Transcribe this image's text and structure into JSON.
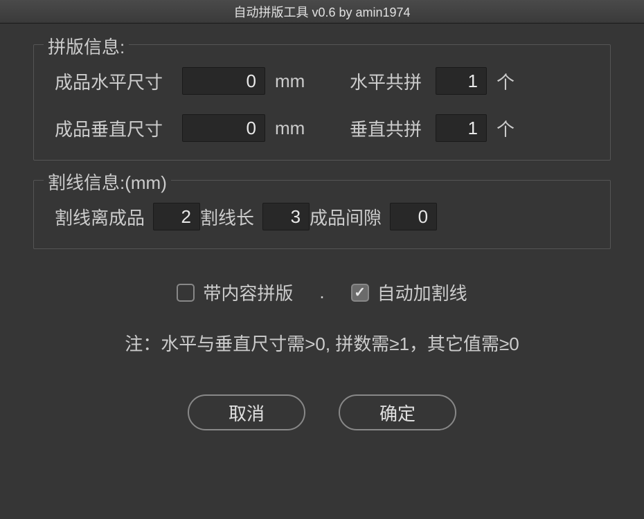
{
  "title": "自动拼版工具 v0.6   by amin1974",
  "imposition": {
    "legend": "拼版信息:",
    "horizontal_size_label": "成品水平尺寸",
    "horizontal_size_value": "0",
    "horizontal_size_unit": "mm",
    "horizontal_count_label": "水平共拼",
    "horizontal_count_value": "1",
    "horizontal_count_unit": "个",
    "vertical_size_label": "成品垂直尺寸",
    "vertical_size_value": "0",
    "vertical_size_unit": "mm",
    "vertical_count_label": "垂直共拼",
    "vertical_count_value": "1",
    "vertical_count_unit": "个"
  },
  "cutline": {
    "legend": "割线信息:(mm)",
    "offset_label": "割线离成品",
    "offset_value": "2",
    "length_label": "割线长",
    "length_value": "3",
    "gap_label": "成品间隙",
    "gap_value": "0"
  },
  "checkboxes": {
    "with_content_label": "带内容拼版",
    "with_content_checked": false,
    "separator": ".",
    "auto_cutline_label": "自动加割线",
    "auto_cutline_checked": true
  },
  "note": "注：水平与垂直尺寸需>0, 拼数需≥1，其它值需≥0",
  "buttons": {
    "cancel": "取消",
    "ok": "确定"
  }
}
